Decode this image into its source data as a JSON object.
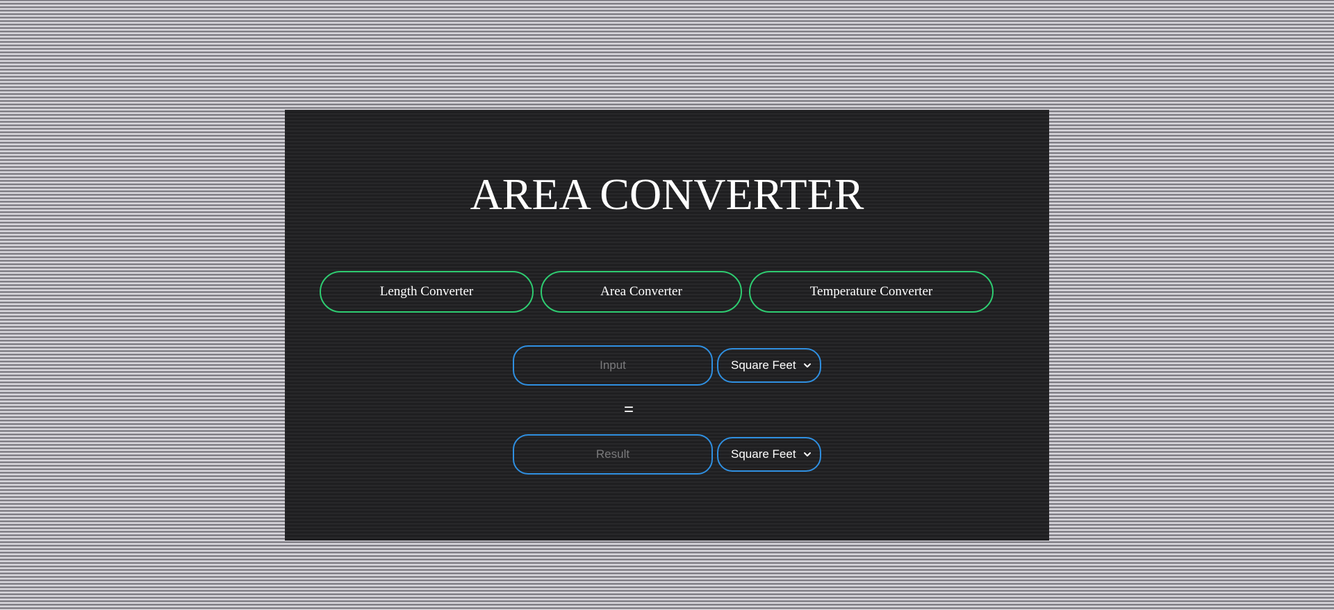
{
  "title": "AREA CONVERTER",
  "nav": {
    "length_label": "Length Converter",
    "area_label": "Area Converter",
    "temperature_label": "Temperature Converter"
  },
  "converter": {
    "input": {
      "value": "",
      "placeholder": "Input"
    },
    "input_unit": {
      "selected": "Square Feet"
    },
    "equals": "=",
    "result": {
      "value": "",
      "placeholder": "Result"
    },
    "result_unit": {
      "selected": "Square Feet"
    }
  },
  "colors": {
    "nav_border": "#2ecc71",
    "field_border": "#2f8fe0",
    "panel_bg": "#222224",
    "text": "#ffffff"
  },
  "icons": {
    "select_arrow": "chevron-down-icon"
  }
}
